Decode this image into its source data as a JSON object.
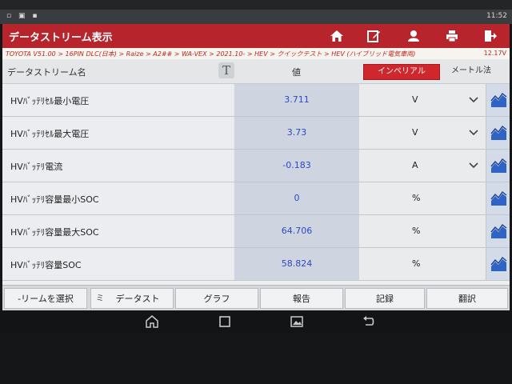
{
  "status_bar": {
    "left_icons": "▫ ▣ ▪",
    "time": "11:52"
  },
  "app": {
    "title": "データストリーム表示",
    "breadcrumb": "TOYOTA V51.00 > 16PIN DLC(日本) > Raize > A2## > WA-VEX > 2021.10- > HEV > クイックテスト > HEV (ハイブリッド電気車両)",
    "battery_voltage": "12.17V"
  },
  "table_header": {
    "name_label": "データストリーム名",
    "font_button": "T",
    "value_label": "値",
    "imperial_label": "インペリアル",
    "metric_label": "メートル法"
  },
  "rows": [
    {
      "name": "HVﾊﾞｯﾃﾘｾﾙ最小電圧",
      "value": "3.711",
      "unit": "V"
    },
    {
      "name": "HVﾊﾞｯﾃﾘｾﾙ最大電圧",
      "value": "3.73",
      "unit": "V"
    },
    {
      "name": "HVﾊﾞｯﾃﾘ電流",
      "value": "-0.183",
      "unit": "A"
    },
    {
      "name": "HVﾊﾞｯﾃﾘ容量最小SOC",
      "value": "0",
      "unit": "%"
    },
    {
      "name": "HVﾊﾞｯﾃﾘ容量最大SOC",
      "value": "64.706",
      "unit": "%"
    },
    {
      "name": "HVﾊﾞｯﾃﾘ容量SOC",
      "value": "58.824",
      "unit": "%"
    }
  ],
  "bottom_buttons": {
    "select": "-リームを選択",
    "datastream_icon": "ミ",
    "datastream": "データスト",
    "graph": "グラフ",
    "report": "報告",
    "record": "記録",
    "translate": "翻訳"
  },
  "colors": {
    "accent": "#b8242b",
    "value_text": "#2a49c8"
  }
}
